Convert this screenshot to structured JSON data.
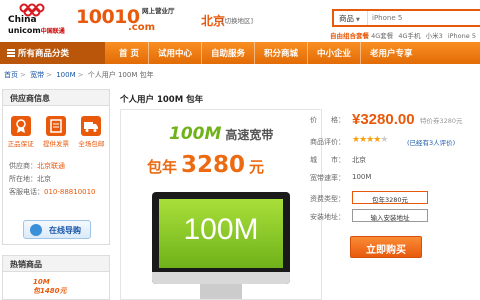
{
  "header": {
    "logo_en1": "China",
    "logo_en2": "unicom",
    "logo_cn": "中国联通",
    "brand_number": "10010",
    "brand_domain": ".com",
    "brand_tagline_1": "网上营业厅",
    "city": "北京",
    "city_switch": "[切换地区]",
    "search_category": "商品",
    "search_placeholder": "iPhone 5",
    "hot_words": [
      "自由组合套餐",
      "4G套餐",
      "4G手机",
      "小米3",
      "iPhone 5"
    ]
  },
  "nav": {
    "category_label": "所有商品分类",
    "items": [
      "首 页",
      "试用中心",
      "自助服务",
      "积分商城",
      "中小企业",
      "老用户专享"
    ]
  },
  "breadcrumb": [
    "首页",
    "宽带",
    "100M",
    "个人用户 100M 包年"
  ],
  "supplier": {
    "heading": "供应商信息",
    "services": [
      "正品保证",
      "提供发票",
      "全场包邮"
    ],
    "info": [
      {
        "key": "供应商：",
        "value": "北京联通"
      },
      {
        "key": "所在地：",
        "value": "北京"
      },
      {
        "key": "客服电话：",
        "value": "010-88810010"
      }
    ],
    "online_button": "在线导购"
  },
  "hot": {
    "heading": "热销商品",
    "thumb_text": "10M",
    "thumb_price": "包1480元"
  },
  "product": {
    "title": "个人用户 100M 包年",
    "image_speed": "100M",
    "image_speed_sub": "高速宽带",
    "image_promo_1": "包年",
    "image_promo_num": "3280",
    "image_promo_2": "元",
    "screen_text": "100M"
  },
  "detail": {
    "price_label": "价　　格：",
    "price": "¥3280.00",
    "original": "特价券3280元",
    "rating_label": "商品评价：",
    "rating": 4,
    "rating_max": 5,
    "review_text": "(已经有3人评价)",
    "city_label": "城　　市：",
    "city_value": "北京",
    "speed_label": "宽带速率：",
    "speed_value": "100M",
    "package_label": "资费类型：",
    "package_value": "包年3280元",
    "address_label": "安装地址：",
    "address_value": "输入安装地址",
    "buy_button": "立即购买"
  },
  "colors": {
    "accent": "#e8590c",
    "nav_dark": "#b9560a",
    "link": "#1a57a8",
    "green": "#6fb21a"
  }
}
